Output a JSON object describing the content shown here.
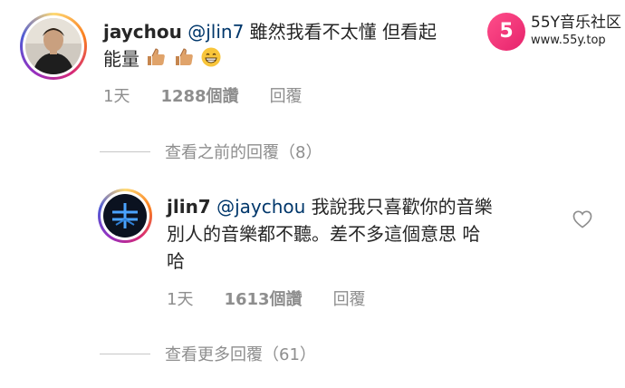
{
  "comment": {
    "username": "jaychou",
    "mention": "@jlin7",
    "text_line1": " 雖然我看不太懂 但看起",
    "text_line2": "能量",
    "time": "1天",
    "likes": "1288個讚",
    "reply_label": "回覆"
  },
  "view_previous": "查看之前的回覆（8）",
  "reply": {
    "username": "jlin7",
    "mention": "@jaychou",
    "text_line1": " 我說我只喜歡你的音樂",
    "text_line2": "別人的音樂都不聽。差不多這個意思 哈",
    "text_line3": "哈",
    "time": "1天",
    "likes": "1613個讚",
    "reply_label": "回覆"
  },
  "view_more": "查看更多回覆（61）",
  "watermark": {
    "logo_char": "5",
    "title": "55Y音乐社区",
    "url": "www.55y.top"
  },
  "icons": [
    "thumbs-up-icon",
    "thumbs-up-icon",
    "grinning-emoji-icon",
    "heart-icon"
  ],
  "colors": {
    "mention": "#00376b",
    "muted": "#8e8e8e",
    "text": "#262626"
  }
}
